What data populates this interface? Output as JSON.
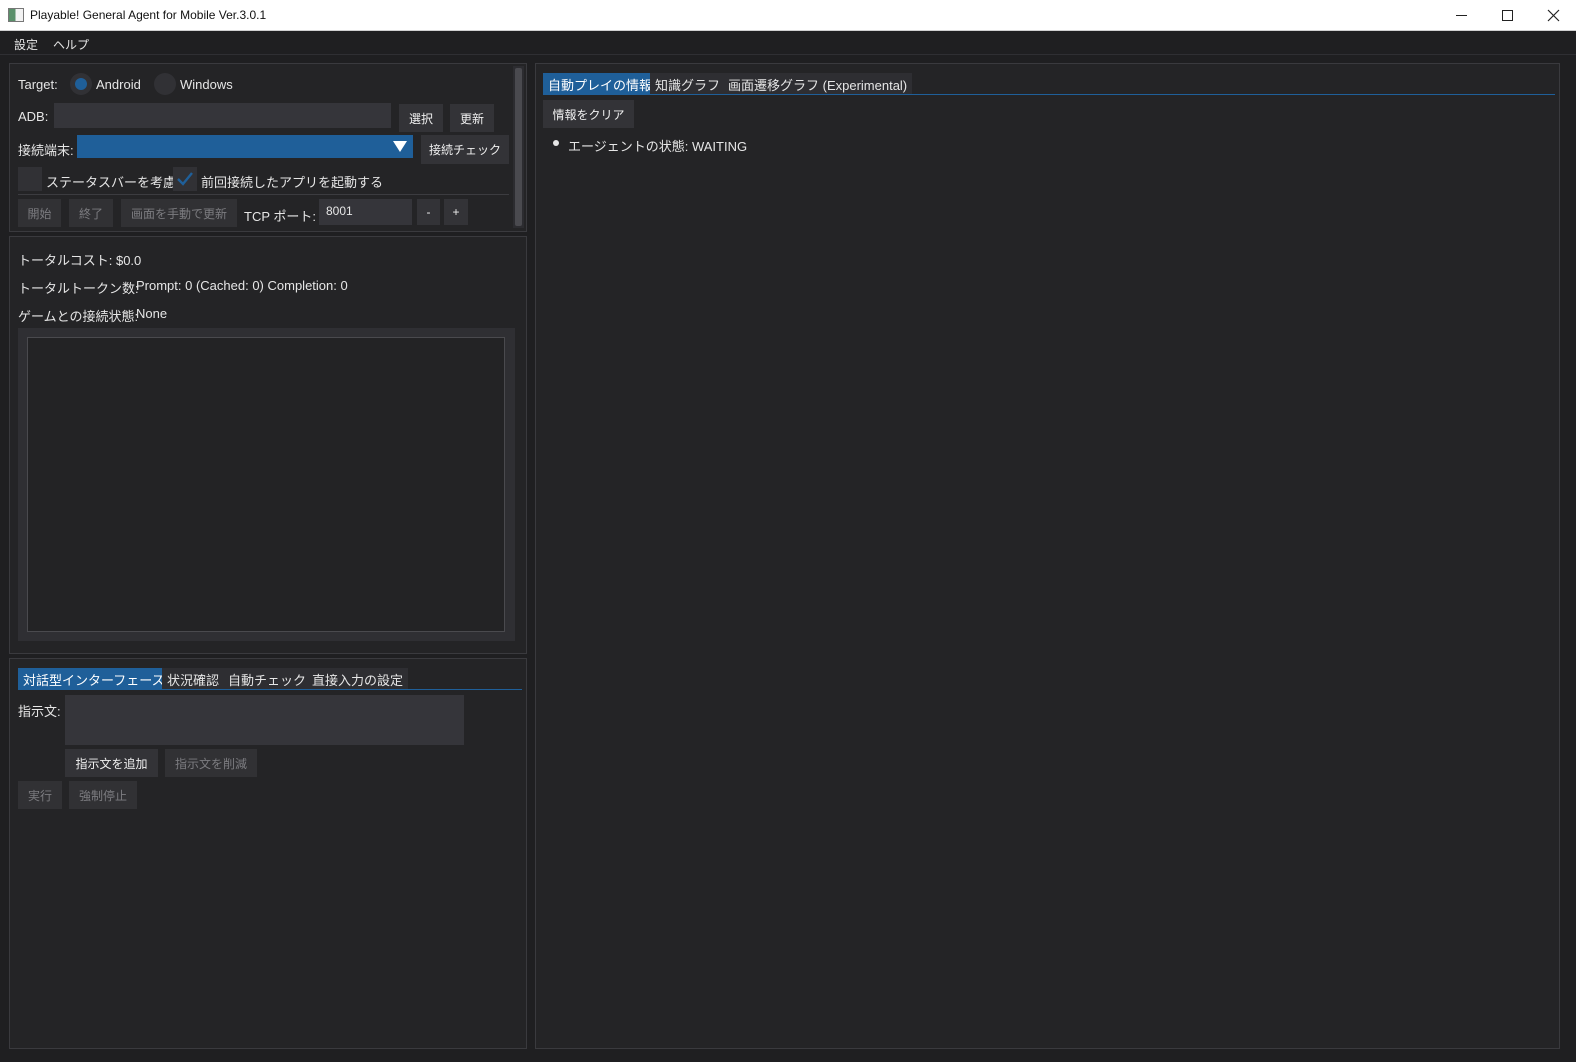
{
  "window": {
    "title": "Playable! General Agent for Mobile Ver.3.0.1"
  },
  "menu": {
    "items": [
      "設定",
      "ヘルプ"
    ]
  },
  "connection": {
    "target_label": "Target:",
    "target_options": [
      "Android",
      "Windows"
    ],
    "target_selected": "Android",
    "adb_label": "ADB:",
    "adb_value": "",
    "select_button": "選択",
    "refresh_button": "更新",
    "device_label": "接続端末:",
    "device_value": "",
    "check_connection_button": "接続チェック",
    "statusbar_checkbox": {
      "label": "ステータスバーを考慮",
      "checked": false
    },
    "launch_last_app_checkbox": {
      "label": "前回接続したアプリを起動する",
      "checked": true
    },
    "start_button": "開始",
    "stop_button": "終了",
    "manual_refresh_button": "画面を手動で更新",
    "tcp_port_label": "TCP ポート:",
    "tcp_port_value": "8001",
    "decrement_button": "-",
    "increment_button": "+"
  },
  "stats": {
    "total_cost": "トータルコスト: $0.0",
    "total_tokens_label": "トータルトークン数:",
    "total_tokens_value": "Prompt: 0 (Cached: 0) Completion: 0",
    "game_connection_label": "ゲームとの接続状態:",
    "game_connection_value": "None"
  },
  "interaction": {
    "tabs": [
      "対話型インターフェース",
      "状況確認",
      "自動チェック",
      "直接入力の設定"
    ],
    "active_tab": 0,
    "instruction_label": "指示文:",
    "instruction_value": "",
    "add_instruction_button": "指示文を追加",
    "remove_instruction_button": "指示文を削減",
    "run_button": "実行",
    "force_stop_button": "強制停止"
  },
  "info_panel": {
    "tabs": [
      "自動プレイの情報",
      "知識グラフ",
      "画面遷移グラフ (Experimental)"
    ],
    "active_tab": 0,
    "clear_button": "情報をクリア",
    "agent_state": "エージェントの状態: WAITING"
  },
  "colors": {
    "accent": "#1f5f99",
    "background": "#1f1f21",
    "panel": "#242426"
  }
}
